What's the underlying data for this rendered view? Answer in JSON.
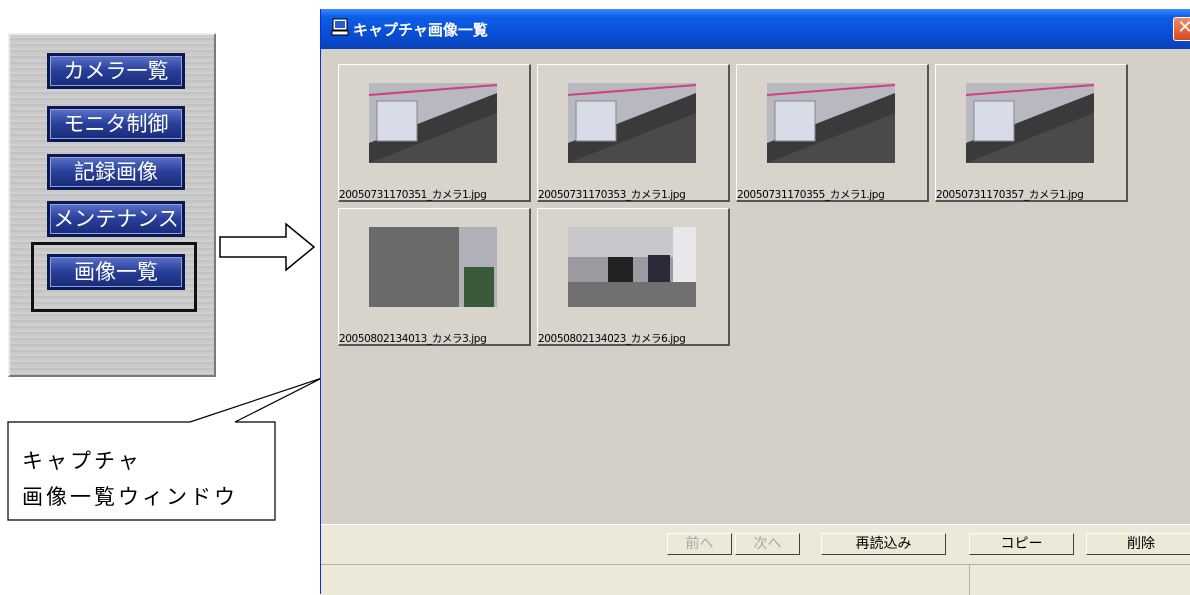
{
  "menu": {
    "buttons": [
      {
        "label": "カメラ一覧"
      },
      {
        "label": "モニタ制御"
      },
      {
        "label": "記録画像"
      },
      {
        "label": "メンテナンス"
      },
      {
        "label": "画像一覧"
      }
    ]
  },
  "callout": {
    "line1": "キャプチャ",
    "line2": "画像一覧ウィンドウ"
  },
  "window": {
    "title": "キャプチャ画像一覧",
    "close_label": "✕",
    "thumbnails": [
      {
        "caption": "20050731170351_カメラ1.jpg"
      },
      {
        "caption": "20050731170353_カメラ1.jpg"
      },
      {
        "caption": "20050731170355_カメラ1.jpg"
      },
      {
        "caption": "20050731170357_カメラ1.jpg"
      },
      {
        "caption": "20050802134013_カメラ3.jpg"
      },
      {
        "caption": "20050802134023_カメラ6.jpg"
      }
    ],
    "buttons": {
      "prev": "前へ",
      "next": "次へ",
      "reload": "再読込み",
      "copy": "コピー",
      "delete": "削除"
    }
  },
  "colors": {
    "menu_button": "#283e98",
    "titlebar": "#0a4fd6",
    "close": "#d84820"
  }
}
